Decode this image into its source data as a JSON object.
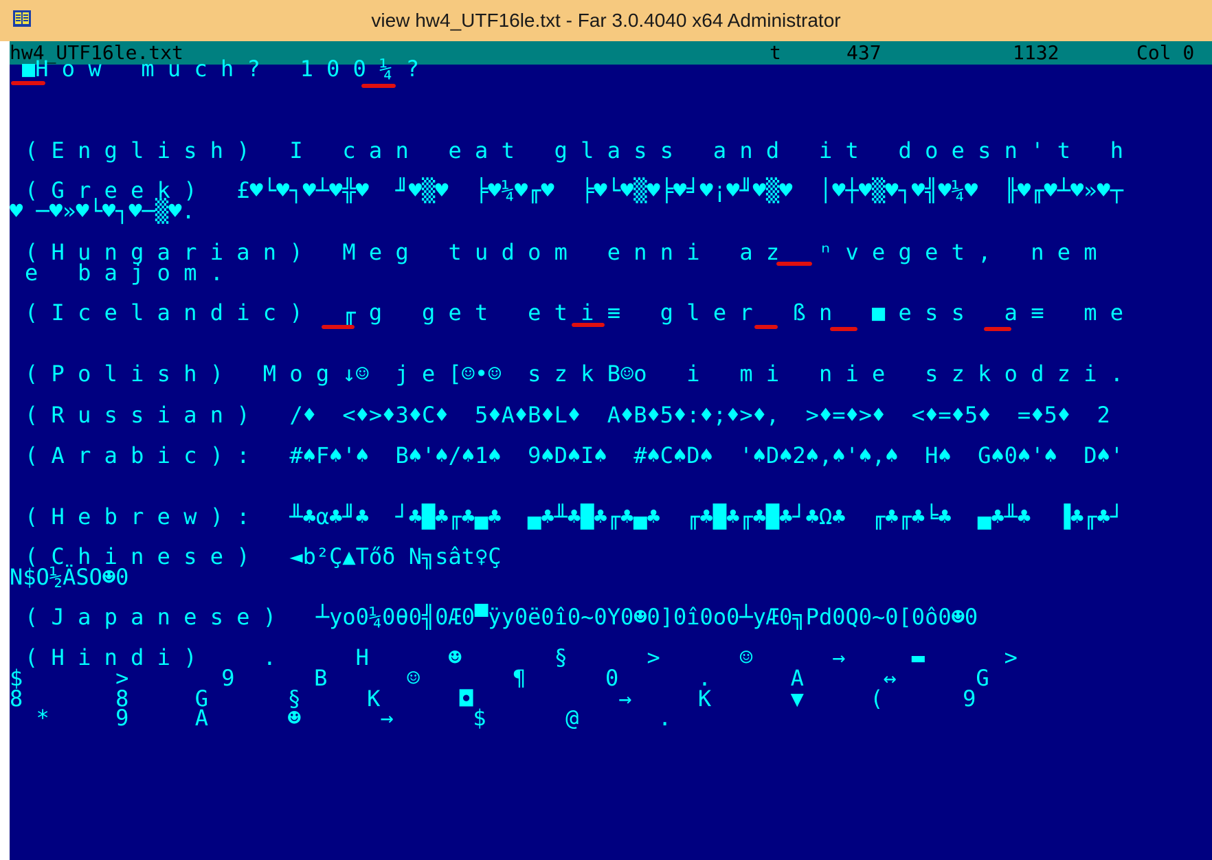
{
  "window": {
    "title": "view hw4_UTF16le.txt - Far 3.0.4040 x64 Administrator",
    "icon": "far-manager-icon"
  },
  "colors": {
    "titlebar": "#f6c97f",
    "viewer_bg": "#000080",
    "viewer_text": "#00ffff",
    "statusbar_bg": "#008080",
    "marker": "#e01010"
  },
  "status": {
    "filename": "hw4_UTF16le.txt",
    "codepage": "t",
    "offset": "437",
    "size": "1132",
    "col": "Col 0"
  },
  "lines": [
    {
      "id": "how-much",
      "text": "■H o w   m u c h ?   1 0 0 ¼ ?"
    },
    {
      "id": "english",
      "text": "( E n g l i s h )   I   c a n   e a t   g l a s s   a n d   i t   d o e s n ' t   h"
    },
    {
      "id": "greek",
      "text": "( G r e e k )   £♥└♥┐♥┴♥╬♥  ╜♥▒♥  ╞♥¼♥╓♥  ╞♥└♥▒♥╞♥╛♥¡♥╜♥▒♥  │♥┼♥▒♥┐♥╣♥¼♥  ╟♥╓♥┴♥»♥┬"
    },
    {
      "id": "greek-cont",
      "text": "♥ ─♥»♥└♥┐♥─▒♥."
    },
    {
      "id": "hungarian",
      "text": "( H u n g a r i a n )   M e g   t u d o m   e n n i   a z   ⁿ v e g e t ,   n e m"
    },
    {
      "id": "hungarian-cont",
      "text": "e   b a j o m ."
    },
    {
      "id": "icelandic",
      "text": "( I c e l a n d i c )   ╓ g   g e t   e t i ≡   g l e r   ß n   ■ e s s   a ≡   m e"
    },
    {
      "id": "polish",
      "text": "( P o l i s h )   M o g ↓☺  j e [☺•☺  s z k B☺o   i   m i   n i e   s z k o d z i ."
    },
    {
      "id": "russian",
      "text": "( R u s s i a n )   /♦  <♦>♦3♦C♦  5♦A♦B♦L♦  A♦B♦5♦:♦;♦>♦,  >♦=♦>♦  <♦=♦5♦  =♦5♦  2"
    },
    {
      "id": "arabic",
      "text": "( A r a b i c ) :   #♠F♠'♠  B♠'♠/♠1♠  9♠D♠I♠  #♠C♠D♠  '♠D♠2♠,♠'♠,♠  H♠  G♠0♠'♠  D♠'"
    },
    {
      "id": "hebrew",
      "text": "( H e b r e w ) :   ╨♣α♣╜♣  ┘♣█♣╓♣▄♣  ▄♣╨♣█♣╓♣▄♣  ╓♣█♣╓♣█♣┘♣Ω♣  ╓♣╓♣╘♣  ▄♣╨♣  ▐♣╓♣┘"
    },
    {
      "id": "chinese",
      "text": "( C h i n e s e )   ◄b²Ç▲Tőδ N╗sât♀Ç"
    },
    {
      "id": "chinese-cont",
      "text": "N$O½ÄSO☻0"
    },
    {
      "id": "japanese",
      "text": "( J a p a n e s e )   ┴yo0¼0θ0╣0Æ0▀ÿy0ë0î0~0Y0☻0]0î0o0┴yÆ0╗Pd0Q0~0[0ô0☻0"
    },
    {
      "id": "hindi",
      "text": "( H i n d i )     .      H      ☻       §      >      ☺      →     ▬      >"
    },
    {
      "id": "hindi-2",
      "text": "$       >       9      B      ☺       ¶      0      .      A      ↔      G"
    },
    {
      "id": "hindi-3",
      "text": "8       8     G      §     K      ◘           →     K      ▼     (      9"
    },
    {
      "id": "hindi-4",
      "text": "  *     9     A      ☻      →      $      @      ."
    }
  ]
}
